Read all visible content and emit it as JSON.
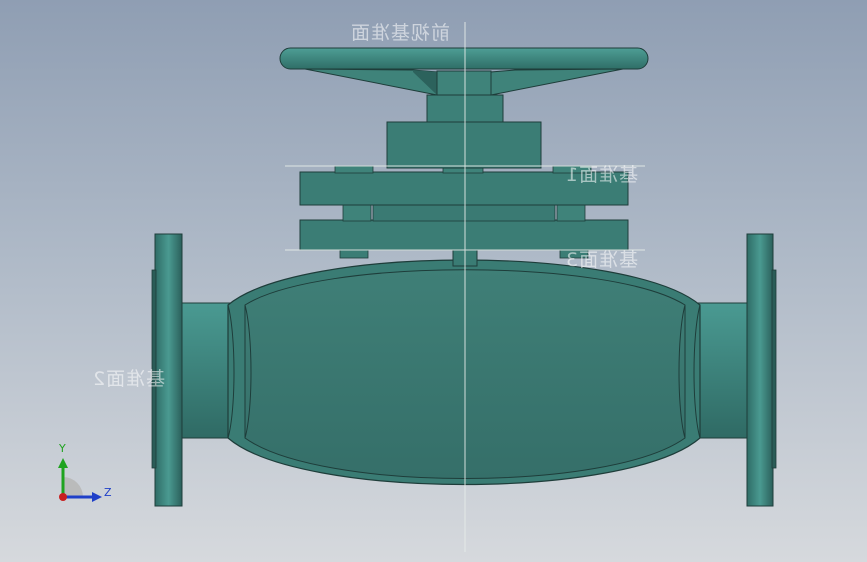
{
  "viewport": {
    "background_top": "#8f9eb3",
    "background_bottom": "#d6d9dd",
    "model_color": "#3f8178",
    "model_edge_color": "#1e3d3a"
  },
  "plane_labels": {
    "front_plane": "前视基准面",
    "plane_1": "基准面1",
    "plane_2": "基准面2",
    "plane_3": "基准面3"
  },
  "triad": {
    "y_label": "Y",
    "z_label": "Z",
    "y_color": "#1fa31f",
    "z_color": "#1f3fc8",
    "x_color": "#c81f1f"
  },
  "icons": [
    "handwheel-icon",
    "axis-triad-icon"
  ]
}
